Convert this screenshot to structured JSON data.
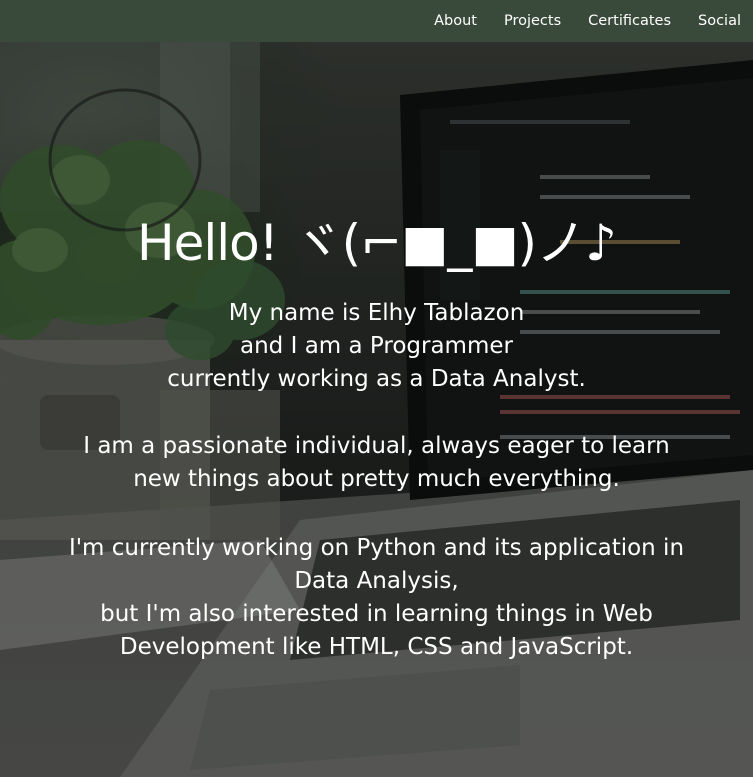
{
  "nav": {
    "items": [
      {
        "label": "About"
      },
      {
        "label": "Projects"
      },
      {
        "label": "Certificates"
      },
      {
        "label": "Social"
      }
    ]
  },
  "hero": {
    "title": "Hello! ヾ(⌐■_■)ノ♪",
    "intro_lines": [
      "My name is Elhy Tablazon",
      "and I am a Programmer",
      "currently working as a Data Analyst."
    ],
    "passion_lines": [
      "I am a passionate individual, always eager to learn",
      "new things about pretty much everything."
    ],
    "interest_lines": [
      "I'm currently working on Python and its application in",
      "Data Analysis,",
      "but I'm also interested in learning things in Web",
      "Development like HTML, CSS and JavaScript."
    ],
    "background_image": "laptop-with-code-and-plant-photo"
  },
  "colors": {
    "navbar_bg": "#3a4a3a",
    "text": "#ffffff"
  }
}
